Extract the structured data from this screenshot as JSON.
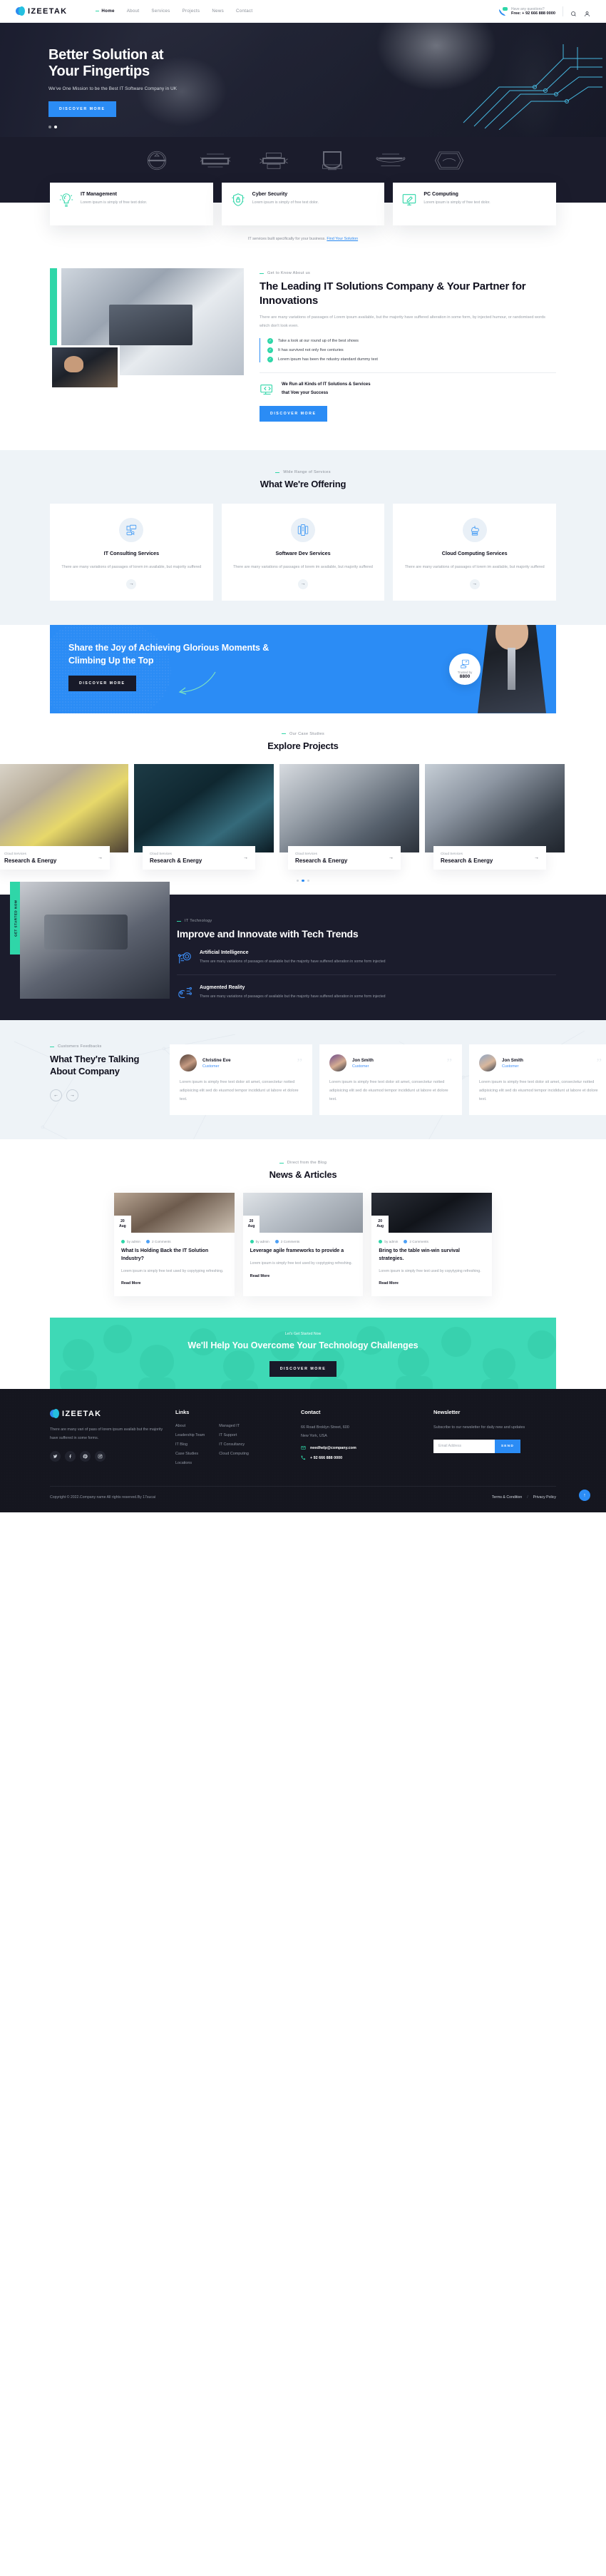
{
  "brand": {
    "name": "IZEETAK"
  },
  "header": {
    "nav": [
      {
        "label": "Home",
        "active": true
      },
      {
        "label": "About",
        "active": false
      },
      {
        "label": "Services",
        "active": false
      },
      {
        "label": "Projects",
        "active": false
      },
      {
        "label": "News",
        "active": false
      },
      {
        "label": "Contact",
        "active": false
      }
    ],
    "phone_label": "Have any questions?",
    "phone_number": "Free: + 92 666 888 0000",
    "search_icon": "search-icon",
    "account_icon": "user-icon"
  },
  "hero": {
    "title_line1": "Better Solution at",
    "title_line2": "Your Fingertips",
    "subtitle": "We've One Mission to be the Best IT Software Company in UK",
    "cta": "DISCOVER MORE",
    "slides": 2,
    "active_slide": 2
  },
  "brands": [
    {
      "name": "CUPCAKERY"
    },
    {
      "name": "NEW EXPERIENCES"
    },
    {
      "name": "National MILES"
    },
    {
      "name": "BRAND GRILL HOUSE"
    },
    {
      "name": "BRONXS"
    },
    {
      "name": "Sparonio"
    }
  ],
  "features": [
    {
      "icon": "bulb-brain-icon",
      "title": "IT Management",
      "text": "Lorem ipsum is simply of free text dolor."
    },
    {
      "icon": "shield-lock-icon",
      "title": "Cyber Security",
      "text": "Lorem ipsum is simply of free text dolor."
    },
    {
      "icon": "monitor-pen-icon",
      "title": "PC Computing",
      "text": "Lorem ipsum is simply of free text dolor."
    }
  ],
  "built_note": {
    "text": "IT services built specifically for your business.",
    "link": "Find Your Solution"
  },
  "about": {
    "eyebrow": "Get to Know About us",
    "title": "The Leading IT Solutions Company & Your Partner for Innovations",
    "paragraph": "There are many variations of passages of Lorem ipsum available, but the majority have suffered alteration in some form, by injected humour, or randomised words which don't look even.",
    "ticks": [
      "Take a look at our round up of the best shows",
      "It has survived not only five centuries",
      "Lorem ipsum has been the ndustry standard dummy text"
    ],
    "run_line1": "We Run all Kinds of IT Solutions & Services",
    "run_line2": "that Vow your Success",
    "cta": "DISCOVER MORE"
  },
  "offering": {
    "eyebrow": "Wide Range of Services",
    "title": "What We're Offering",
    "cards": [
      {
        "icon": "consulting-icon",
        "title": "IT Consulting Services",
        "text": "There are many variations of passages of lorem im available, but majority suffered",
        "arrow": "→"
      },
      {
        "icon": "mobile-dev-icon",
        "title": "Software Dev Services",
        "text": "There are many variations of passages of lorem im available, but majority suffered",
        "arrow": "→"
      },
      {
        "icon": "cloud-server-icon",
        "title": "Cloud Computing Services",
        "text": "There are many variations of passages of lorem im available, but majority suffered",
        "arrow": "→"
      }
    ]
  },
  "blue_cta": {
    "title": "Share the Joy of Achieving Glorious Moments & Climbing Up the Top",
    "cta": "DISCOVER MORE",
    "badge_label": "Trusted by",
    "badge_value": "8800",
    "badge_icon": "thumbs-up-shield-icon"
  },
  "projects": {
    "eyebrow": "Our Case Studies",
    "title": "Explore Projects",
    "items": [
      {
        "category": "Cloud Services",
        "title": "Research & Energy",
        "arrow": "→"
      },
      {
        "category": "Cloud Services",
        "title": "Research & Energy",
        "arrow": "→"
      },
      {
        "category": "Cloud Services",
        "title": "Research & Energy",
        "arrow": "→"
      },
      {
        "category": "Cloud Services",
        "title": "Research & Energy",
        "arrow": "→"
      }
    ],
    "dots": 3,
    "active_dot": 2
  },
  "trends": {
    "vertical_label": "GET STARTED NOW",
    "eyebrow": "IT Technology",
    "title": "Improve and Innovate with Tech Trends",
    "items": [
      {
        "icon": "ai-head-icon",
        "title": "Artificial Intelligence",
        "text": "There are many variations of passages of available but the majority have suffered alteration in some form injected"
      },
      {
        "icon": "ar-icon",
        "title": "Augmented Reality",
        "text": "There are many variations of passages of available but the majority have suffered alteration in some form injected"
      }
    ]
  },
  "testimonials": {
    "eyebrow": "Customers Feedbacks",
    "title": "What They're Talking About Company",
    "prev_icon": "arrow-left-icon",
    "next_icon": "arrow-right-icon",
    "items": [
      {
        "name": "Christine Eve",
        "role": "Customer",
        "text": "Lorem ipsum is simply free text dolor sit amet, consectetur notted adipisicing elit sed do eiusmod tempor incididunt ut labore et dolore text."
      },
      {
        "name": "Jon Smith",
        "role": "Customer",
        "text": "Lorem ipsum is simply free text dolor sit amet, consectetur notted adipisicing elit sed do eiusmod tempor incididunt ut labore et dolore text."
      },
      {
        "name": "Jon Smith",
        "role": "Customer",
        "text": "Lorem ipsum is simply free text dolor sit amet, consectetur notted adipisicing elit sed do eiusmod tempor incididunt ut labore et dolore text."
      }
    ]
  },
  "news": {
    "eyebrow": "Direct from the Blog",
    "title": "News & Articles",
    "posts": [
      {
        "day": "20",
        "month": "Aug",
        "author": "by admin",
        "comments": "2 Comments",
        "title": "What Is Holding Back the IT Solution Industry?",
        "excerpt": "Lorem ipsum is simply free text used by copytyping refreshing.",
        "more": "Read More"
      },
      {
        "day": "20",
        "month": "Aug",
        "author": "by admin",
        "comments": "2 Comments",
        "title": "Leverage agile frameworks to provide a",
        "excerpt": "Lorem ipsum is simply free text used by copytyping refreshing.",
        "more": "Read More"
      },
      {
        "day": "20",
        "month": "Aug",
        "author": "by admin",
        "comments": "2 Comments",
        "title": "Bring to the table win-win survival strategies.",
        "excerpt": "Lorem ipsum is simply free text used by copytyping refreshing.",
        "more": "Read More"
      }
    ]
  },
  "teal_cta": {
    "kicker": "Let's Get Started Now",
    "title": "We'll Help You Overcome Your Technology Challenges",
    "cta": "DISCOVER MORE"
  },
  "footer": {
    "description": "There are many vari of pass of lorem ipsum availab but the majority have suffered in some forms.",
    "socials": [
      "twitter-icon",
      "facebook-icon",
      "pinterest-icon",
      "instagram-icon"
    ],
    "links_heading": "Links",
    "links_col1": [
      "About",
      "Leadership Team",
      "IT Blog",
      "Case Studies",
      "Locations"
    ],
    "links_col2": [
      "Managed IT",
      "IT Support",
      "IT Consultancy",
      "Cloud Computing"
    ],
    "contact_heading": "Contact",
    "address_line1": "66 Road Broklyn Street, 600",
    "address_line2": "New York, USA",
    "email": "needhelp@company.com",
    "phone": "+ 92 666 888 0000",
    "newsletter_heading": "Newsletter",
    "newsletter_text": "Subscribe to our newsletter for daily new and updates",
    "email_placeholder": "Email Address",
    "email_value": "",
    "send_label": "SEND",
    "copyright": "Copyright © 2022.Company name All rights reserved.By 17sucai",
    "terms": "Terms & Condition",
    "separator": "/",
    "privacy": "Privacy Policy",
    "to_top_icon": "arrow-up-icon"
  },
  "colors": {
    "accent_blue": "#2b8cf5",
    "accent_teal": "#2fd6a8",
    "dark": "#1b1c2c"
  }
}
